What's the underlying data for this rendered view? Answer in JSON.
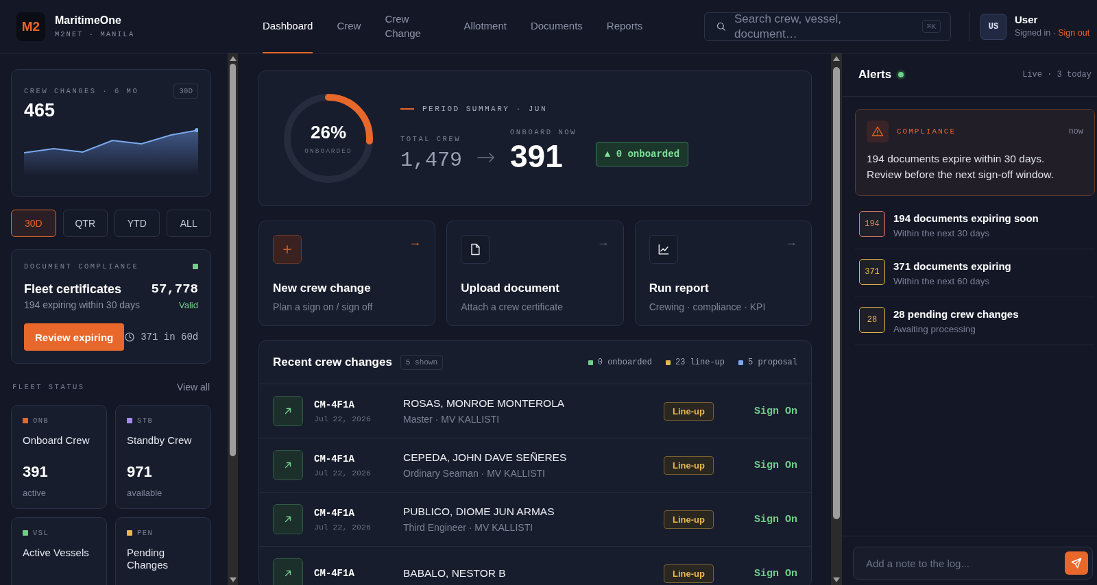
{
  "app": {
    "logo": "M2",
    "name": "MaritimeOne",
    "subtitle": "M2NET · MANILA"
  },
  "nav": [
    {
      "label": "Dashboard",
      "selected": true
    },
    {
      "label": "Crew",
      "selected": false
    },
    {
      "label": "Crew Change",
      "selected": false
    },
    {
      "label": "Allotment",
      "selected": false
    },
    {
      "label": "Documents",
      "selected": false
    },
    {
      "label": "Reports",
      "selected": false
    }
  ],
  "search": {
    "placeholder": "Search crew, vessel, document…",
    "shortcut": "⌘K"
  },
  "user": {
    "initials": "US",
    "name": "User",
    "status": "Signed in ·",
    "link": "Sign out"
  },
  "crew_changes_card": {
    "title": "CREW CHANGES · 6 MO",
    "badge": "30D",
    "value": "465"
  },
  "periods": [
    {
      "label": "30D",
      "selected": true
    },
    {
      "label": "QTR",
      "selected": false
    },
    {
      "label": "YTD",
      "selected": false
    },
    {
      "label": "ALL",
      "selected": false
    }
  ],
  "compliance": {
    "title": "DOCUMENT COMPLIANCE",
    "heading": "Fleet certificates",
    "note": "194 expiring within 30 days",
    "count": "57,778",
    "count_status": "Valid",
    "button": "Review expiring",
    "expiring_60": "371 in 60d"
  },
  "fleet_status": {
    "title": "FLEET STATUS",
    "link": "View all",
    "cards": [
      {
        "code": "ONB",
        "color": "#e8672a",
        "name": "Onboard Crew",
        "value": "391",
        "note": "active"
      },
      {
        "code": "STB",
        "color": "#a48cf0",
        "name": "Standby Crew",
        "value": "971",
        "note": "available"
      },
      {
        "code": "VSL",
        "color": "#6fcf8a",
        "name": "Active Vessels"
      },
      {
        "code": "PEN",
        "color": "#e8b94a",
        "name": "Pending Changes"
      }
    ]
  },
  "summary": {
    "level": 0.26,
    "percent": "26%",
    "percent_label": "ONBOARDED",
    "title": "PERIOD SUMMARY · JUN",
    "total_label": "TOTAL CREW",
    "total": "1,479",
    "onboard_label": "ONBOARD NOW",
    "onboard": "391",
    "delta": "▲ 0 onboarded"
  },
  "actions": [
    {
      "kind": "add",
      "title": "New crew change",
      "subtitle": "Plan a sign on / sign off",
      "arrow": "→"
    },
    {
      "kind": "document",
      "title": "Upload document",
      "subtitle": "Attach a crew certificate",
      "arrow": "→"
    },
    {
      "kind": "report",
      "title": "Run report",
      "subtitle": "Crewing · compliance · KPI",
      "arrow": "→"
    }
  ],
  "recent": {
    "title": "Recent crew changes",
    "count": "5 shown",
    "legend": [
      {
        "label": "0 onboarded",
        "color": "#6fcf8a"
      },
      {
        "label": "23 line-up",
        "color": "#e8b94a"
      },
      {
        "label": "5 proposal",
        "color": "#7aa9ee"
      }
    ],
    "rows": [
      {
        "id": "CM-4F1A",
        "date": "Jul 22, 2026",
        "name": "ROSAS, MONROE MONTEROLA",
        "role": "Master · MV KALLISTI",
        "status": "Line-up",
        "action": "Sign On"
      },
      {
        "id": "CM-4F1A",
        "date": "Jul 22, 2026",
        "name": "CEPEDA, JOHN DAVE SEÑERES",
        "role": "Ordinary Seaman · MV KALLISTI",
        "status": "Line-up",
        "action": "Sign On"
      },
      {
        "id": "CM-4F1A",
        "date": "Jul 22, 2026",
        "name": "PUBLICO, DIOME JUN ARMAS",
        "role": "Third Engineer · MV KALLISTI",
        "status": "Line-up",
        "action": "Sign On"
      },
      {
        "id": "CM-4F1A",
        "name": "BABALO, NESTOR B",
        "status": "Line-up",
        "action": "Sign On"
      }
    ]
  },
  "alerts": {
    "title": "Alerts",
    "live": true,
    "meta": "Live · 3 today",
    "featured": {
      "category": "COMPLIANCE",
      "time": "now",
      "message": "194 documents expire within 30 days. Review before the next sign-off window."
    },
    "items": [
      {
        "count": "194",
        "color": "#e0806e",
        "title": "194 documents expiring soon",
        "subtitle": "Within the next 30 days"
      },
      {
        "count": "371",
        "color": "#e8b94a",
        "title": "371 documents expiring",
        "subtitle": "Within the next 60 days"
      },
      {
        "count": "28",
        "color": "#e8b94a",
        "title": "28 pending crew changes",
        "subtitle": "Awaiting processing"
      }
    ],
    "note": {
      "placeholder": "Add a note to the log..."
    }
  }
}
